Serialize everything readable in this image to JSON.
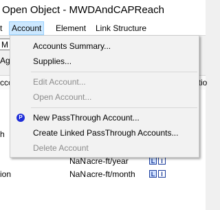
{
  "window": {
    "title": "Open Object - MWDAndCAPReach"
  },
  "menubar": {
    "items": [
      {
        "label": "t"
      },
      {
        "label": "Account"
      },
      {
        "label": "Element"
      },
      {
        "label": "Link Structure"
      }
    ]
  },
  "background": {
    "field_value": "M",
    "tab_label": "Ag",
    "header": {
      "left": "ccc",
      "right": "otio"
    },
    "left_fragment": "h",
    "rows": [
      {
        "value": "NaN",
        "unit": "acre-ft/year"
      },
      {
        "prefix": "ion",
        "value": "NaN",
        "unit": "acre-ft/month"
      }
    ],
    "badges": [
      "L",
      "I"
    ]
  },
  "account_menu": {
    "items": [
      {
        "label": "Accounts Summary...",
        "enabled": true
      },
      {
        "label": "Supplies...",
        "enabled": true
      },
      {
        "label": "Edit Account...",
        "enabled": false
      },
      {
        "label": "Open Account...",
        "enabled": false
      },
      {
        "label": "New PassThrough Account...",
        "enabled": true,
        "icon": "passthrough-icon",
        "icon_text": "P"
      },
      {
        "label": "Create Linked PassThrough Accounts...",
        "enabled": true
      },
      {
        "label": "Delete Account",
        "enabled": false
      }
    ]
  },
  "colors": {
    "menu_active_bg": "#cce8ff",
    "menu_active_border": "#99d1ff",
    "disabled_text": "#8c8c8c",
    "passthrough_icon": "#1f2ed8"
  }
}
